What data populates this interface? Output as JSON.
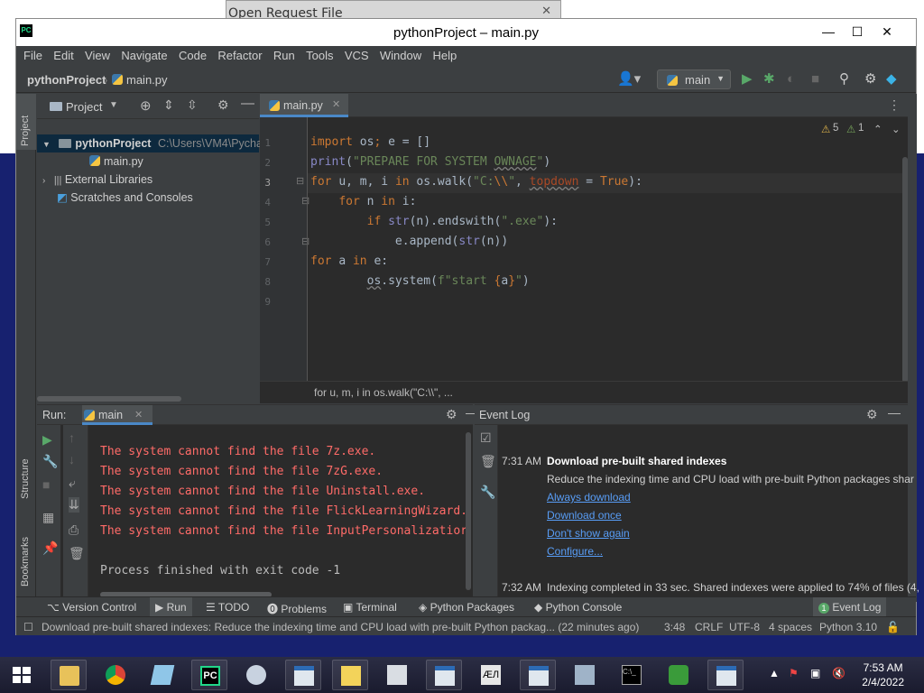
{
  "background_window": {
    "title": "Open Request File",
    "close": "✕"
  },
  "window": {
    "title": "pythonProject – main.py",
    "logo": "PC",
    "controls": {
      "minimize": "—",
      "maximize": "☐",
      "close": "✕"
    }
  },
  "menu": [
    "File",
    "Edit",
    "View",
    "Navigate",
    "Code",
    "Refactor",
    "Run",
    "Tools",
    "VCS",
    "Window",
    "Help"
  ],
  "breadcrumb": {
    "project": "pythonProject",
    "file": "main.py"
  },
  "branch": {
    "label": "main"
  },
  "stripes": {
    "project": "Project",
    "structure": "Structure",
    "bookmarks": "Bookmarks"
  },
  "project_panel": {
    "header": "Project",
    "root_name": "pythonProject",
    "root_path": "C:\\Users\\VM4\\Pycharm",
    "file": "main.py",
    "external": "External Libraries",
    "scratches": "Scratches and Consoles"
  },
  "editor": {
    "tab": "main.py",
    "inspections": {
      "warnings": "5",
      "weak": "1"
    },
    "line_numbers": [
      "1",
      "2",
      "3",
      "4",
      "5",
      "6",
      "7",
      "8",
      "9"
    ],
    "breadcrumb": "for u, m, i in os.walk(\"C:\\\\\", ..."
  },
  "run": {
    "label": "Run:",
    "tab": "main",
    "errors": [
      "The system cannot find the file 7z.exe.",
      "The system cannot find the file 7zG.exe.",
      "The system cannot find the file Uninstall.exe.",
      "The system cannot find the file FlickLearningWizard.",
      "The system cannot find the file InputPersonalizatior"
    ],
    "finished": "Process finished with exit code -1"
  },
  "event_log": {
    "title": "Event Log",
    "events": [
      {
        "time": "7:31 AM",
        "title": "Download pre-built shared indexes",
        "body": "Reduce the indexing time and CPU load with pre-built Python packages shar",
        "links": [
          "Always download",
          "Download once",
          "Don't show again",
          "Configure..."
        ]
      },
      {
        "time": "7:32 AM",
        "body": "Indexing completed in 33 sec. Shared indexes were applied to 74% of files (4,"
      }
    ]
  },
  "tool_windows": [
    "Version Control",
    "Run",
    "TODO",
    "Problems",
    "Terminal",
    "Python Packages",
    "Python Console"
  ],
  "event_log_tab": {
    "badge": "1",
    "label": "Event Log"
  },
  "status": {
    "message": "Download pre-built shared indexes: Reduce the indexing time and CPU load with pre-built Python packag... (22 minutes ago)",
    "position": "3:48",
    "line_sep": "CRLF",
    "encoding": "UTF-8",
    "indent": "4 spaces",
    "interpreter": "Python 3.10"
  },
  "taskbar": {
    "time": "7:53 AM",
    "date": "2/4/2022"
  },
  "colors": {
    "accent": "#4a88c7",
    "error": "#ff6b68",
    "keyword": "#cc7832",
    "string": "#6a8759",
    "link": "#589df6",
    "run_green": "#59a869"
  }
}
